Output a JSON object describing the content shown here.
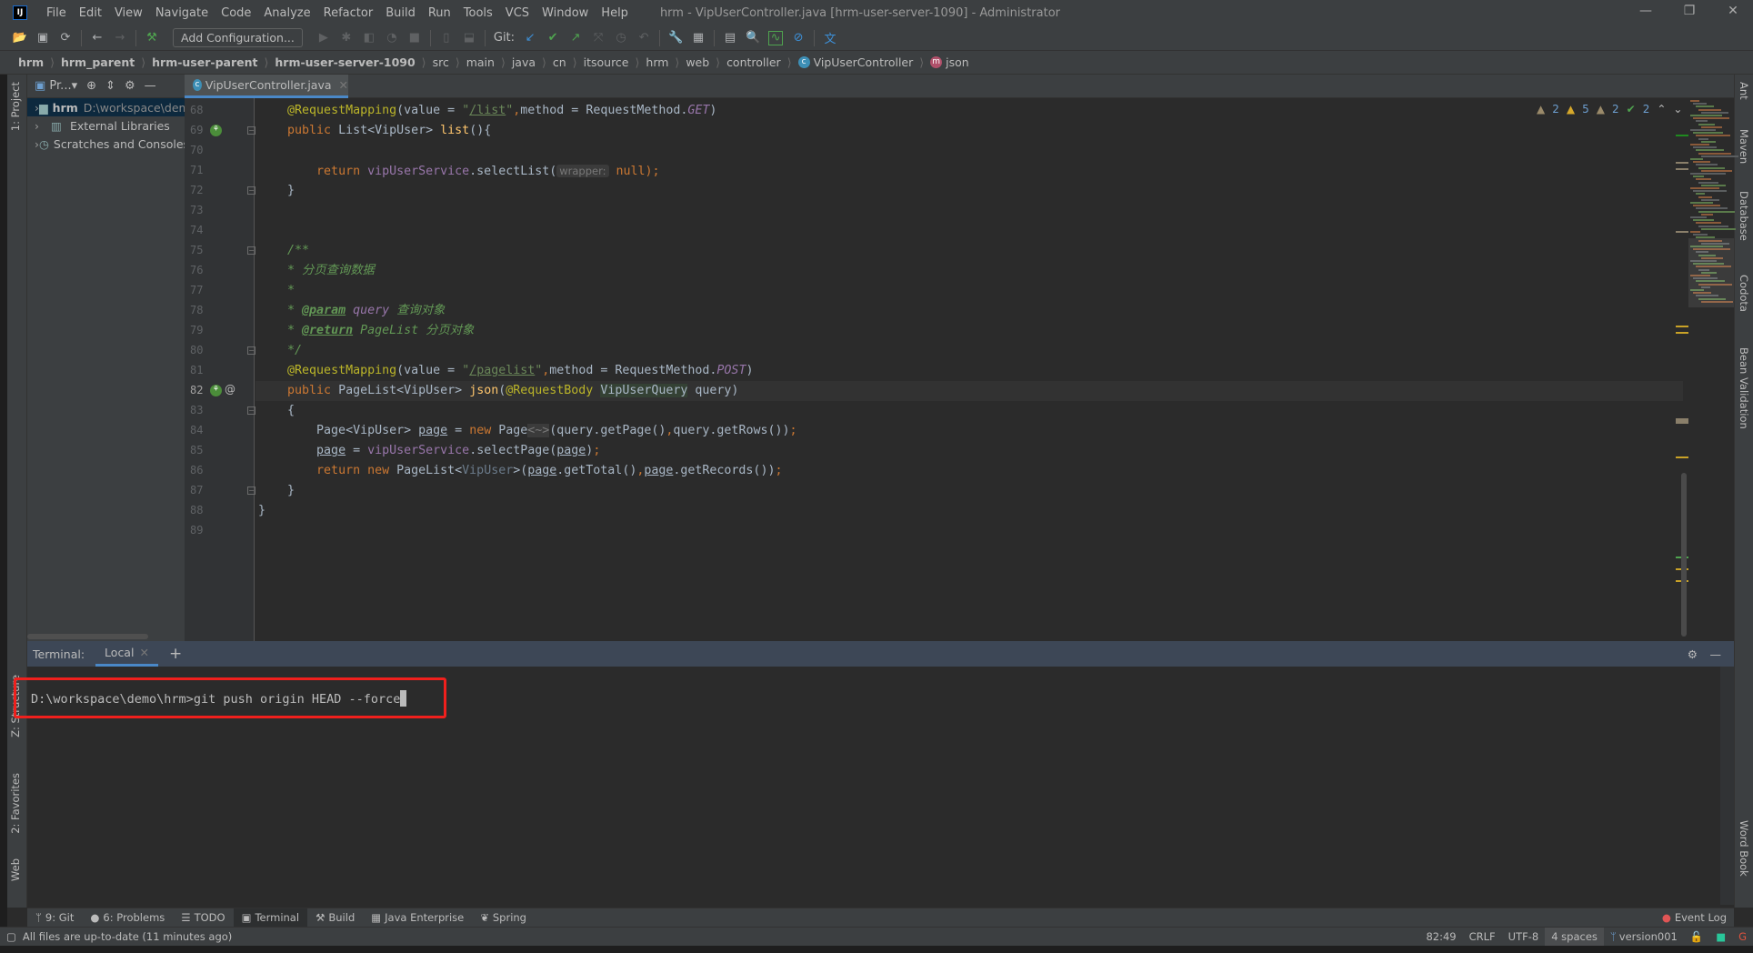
{
  "menu": {
    "items": [
      "File",
      "Edit",
      "View",
      "Navigate",
      "Code",
      "Analyze",
      "Refactor",
      "Build",
      "Run",
      "Tools",
      "VCS",
      "Window",
      "Help"
    ],
    "title": "hrm - VipUserController.java [hrm-user-server-1090] - Administrator"
  },
  "toolbar": {
    "add_configuration": "Add Configuration...",
    "git_label": "Git:"
  },
  "breadcrumb": [
    {
      "label": "hrm",
      "bold": true
    },
    {
      "label": "hrm_parent",
      "bold": true
    },
    {
      "label": "hrm-user-parent",
      "bold": true
    },
    {
      "label": "hrm-user-server-1090",
      "bold": true
    },
    {
      "label": "src"
    },
    {
      "label": "main"
    },
    {
      "label": "java"
    },
    {
      "label": "cn"
    },
    {
      "label": "itsource"
    },
    {
      "label": "hrm"
    },
    {
      "label": "web"
    },
    {
      "label": "controller"
    },
    {
      "label": "VipUserController",
      "icon": "class-icon"
    },
    {
      "label": "json",
      "icon": "method-icon"
    }
  ],
  "project": {
    "header": "Pr...",
    "tree": [
      {
        "name": "hrm",
        "path": "D:\\workspace\\demo\\hrm",
        "selected": true
      },
      {
        "name": "External Libraries"
      },
      {
        "name": "Scratches and Consoles"
      }
    ]
  },
  "left_tabs": {
    "project": "1: Project",
    "structure": "Z: Structure",
    "favorites": "2: Favorites",
    "web": "Web"
  },
  "right_tabs": [
    "Ant",
    "Maven",
    "Database",
    "Codota",
    "Bean Validation",
    "Word Book"
  ],
  "editor": {
    "tab": "VipUserController.java",
    "inspections": {
      "weak_warnings": "2",
      "warnings": "5",
      "typos": "2",
      "ok": "2"
    },
    "current_line": 82,
    "lines": [
      {
        "n": 68,
        "t": [
          [
            "    "
          ],
          [
            "@RequestMapping",
            "an"
          ],
          [
            "(value = "
          ],
          [
            "\"",
            "st"
          ],
          [
            "/list",
            "st ul"
          ],
          [
            "\"",
            "st"
          ],
          [
            ",",
            "kw"
          ],
          [
            "method = RequestMethod."
          ],
          [
            "GET",
            "it"
          ],
          [
            ")"
          ]
        ]
      },
      {
        "n": 69,
        "g": true,
        "f": true,
        "t": [
          [
            "    "
          ],
          [
            "public ",
            "kw"
          ],
          [
            "List<VipUser> "
          ],
          [
            "list",
            "fn"
          ],
          [
            "(){"
          ]
        ]
      },
      {
        "n": 70,
        "t": []
      },
      {
        "n": 71,
        "t": [
          [
            "        "
          ],
          [
            "return ",
            "kw"
          ],
          [
            "vipUserService",
            "fd"
          ],
          [
            ".selectList("
          ],
          [
            "wrapper:",
            "hint"
          ],
          [
            " null",
            "kw"
          ],
          [
            ");",
            "kw"
          ]
        ]
      },
      {
        "n": 72,
        "f": true,
        "t": [
          [
            "    }"
          ]
        ]
      },
      {
        "n": 73,
        "t": []
      },
      {
        "n": 74,
        "t": []
      },
      {
        "n": 75,
        "f": true,
        "t": [
          [
            "    "
          ],
          [
            "/**",
            "cm"
          ]
        ]
      },
      {
        "n": 76,
        "t": [
          [
            "    "
          ],
          [
            "* 分页查询数据",
            "cm"
          ]
        ]
      },
      {
        "n": 77,
        "t": [
          [
            "    "
          ],
          [
            "*",
            "cm"
          ]
        ]
      },
      {
        "n": 78,
        "t": [
          [
            "    "
          ],
          [
            "* ",
            "cm"
          ],
          [
            "@param",
            "cmt"
          ],
          [
            " query ",
            "cm fd"
          ],
          [
            "查询对象",
            "cm"
          ]
        ]
      },
      {
        "n": 79,
        "t": [
          [
            "    "
          ],
          [
            "* ",
            "cm"
          ],
          [
            "@return",
            "cmt"
          ],
          [
            " PageList 分页对象",
            "cm"
          ]
        ]
      },
      {
        "n": 80,
        "f": true,
        "t": [
          [
            "    "
          ],
          [
            "*/",
            "cm"
          ]
        ]
      },
      {
        "n": 81,
        "t": [
          [
            "    "
          ],
          [
            "@RequestMapping",
            "an"
          ],
          [
            "(value = "
          ],
          [
            "\"",
            "st"
          ],
          [
            "/pagelist",
            "st ul"
          ],
          [
            "\"",
            "st"
          ],
          [
            ",",
            "kw"
          ],
          [
            "method = RequestMethod."
          ],
          [
            "POST",
            "it"
          ],
          [
            ")"
          ]
        ]
      },
      {
        "n": 82,
        "g": true,
        "at": true,
        "t": [
          [
            "    "
          ],
          [
            "public ",
            "kw"
          ],
          [
            "PageList<VipUser> "
          ],
          [
            "json",
            "fn"
          ],
          [
            "("
          ],
          [
            "@RequestBody ",
            "an"
          ],
          [
            "VipUserQuery",
            "hl"
          ],
          [
            " query)"
          ]
        ]
      },
      {
        "n": 83,
        "f": true,
        "t": [
          [
            "    {"
          ]
        ]
      },
      {
        "n": 84,
        "t": [
          [
            "        Page<VipUser> "
          ],
          [
            "page",
            "ul"
          ],
          [
            " = "
          ],
          [
            "new ",
            "kw"
          ],
          [
            "Page"
          ],
          [
            "<~>",
            "dg"
          ],
          [
            "(query.getPage()"
          ],
          [
            ",",
            "kw"
          ],
          [
            "query.getRows())"
          ],
          [
            ";",
            "kw"
          ]
        ]
      },
      {
        "n": 85,
        "t": [
          [
            "        "
          ],
          [
            "page",
            "ul"
          ],
          [
            " = "
          ],
          [
            "vipUserService",
            "fd"
          ],
          [
            ".selectPage("
          ],
          [
            "page",
            "ul"
          ],
          [
            ")"
          ],
          [
            ";",
            "kw"
          ]
        ]
      },
      {
        "n": 86,
        "t": [
          [
            "        "
          ],
          [
            "return new ",
            "kw"
          ],
          [
            "PageList<"
          ],
          [
            "VipUser",
            "gr"
          ],
          [
            ">("
          ],
          [
            "page",
            "ul"
          ],
          [
            ".getTotal()"
          ],
          [
            ",",
            "kw"
          ],
          [
            "page",
            "ul"
          ],
          [
            ".getRecords())"
          ],
          [
            ";",
            "kw"
          ]
        ]
      },
      {
        "n": 87,
        "f": true,
        "t": [
          [
            "    }"
          ]
        ]
      },
      {
        "n": 88,
        "t": [
          [
            "}"
          ]
        ]
      },
      {
        "n": 89,
        "t": []
      }
    ]
  },
  "terminal": {
    "label": "Terminal:",
    "tab": "Local",
    "prompt": "D:\\workspace\\demo\\hrm>",
    "command": "git push origin HEAD --force"
  },
  "bottom_tabs": [
    {
      "icon": "git-icon",
      "label": "9: Git"
    },
    {
      "icon": "problems-icon",
      "label": "6: Problems"
    },
    {
      "icon": "todo-icon",
      "label": "TODO"
    },
    {
      "icon": "terminal-icon",
      "label": "Terminal",
      "active": true
    },
    {
      "icon": "build-icon",
      "label": "Build"
    },
    {
      "icon": "java-enterprise-icon",
      "label": "Java Enterprise"
    },
    {
      "icon": "spring-icon",
      "label": "Spring"
    }
  ],
  "event_log": "Event Log",
  "status": {
    "message": "All files are up-to-date (11 minutes ago)",
    "position": "82:49",
    "line_sep": "CRLF",
    "encoding": "UTF-8",
    "indent": "4 spaces",
    "branch": "version001"
  },
  "colors": {
    "accent": "#4a88c7",
    "highlight_box": "#f0201d",
    "keyword": "#cc7832",
    "annotation": "#bbb529",
    "string": "#6a8759",
    "comment": "#629755"
  }
}
